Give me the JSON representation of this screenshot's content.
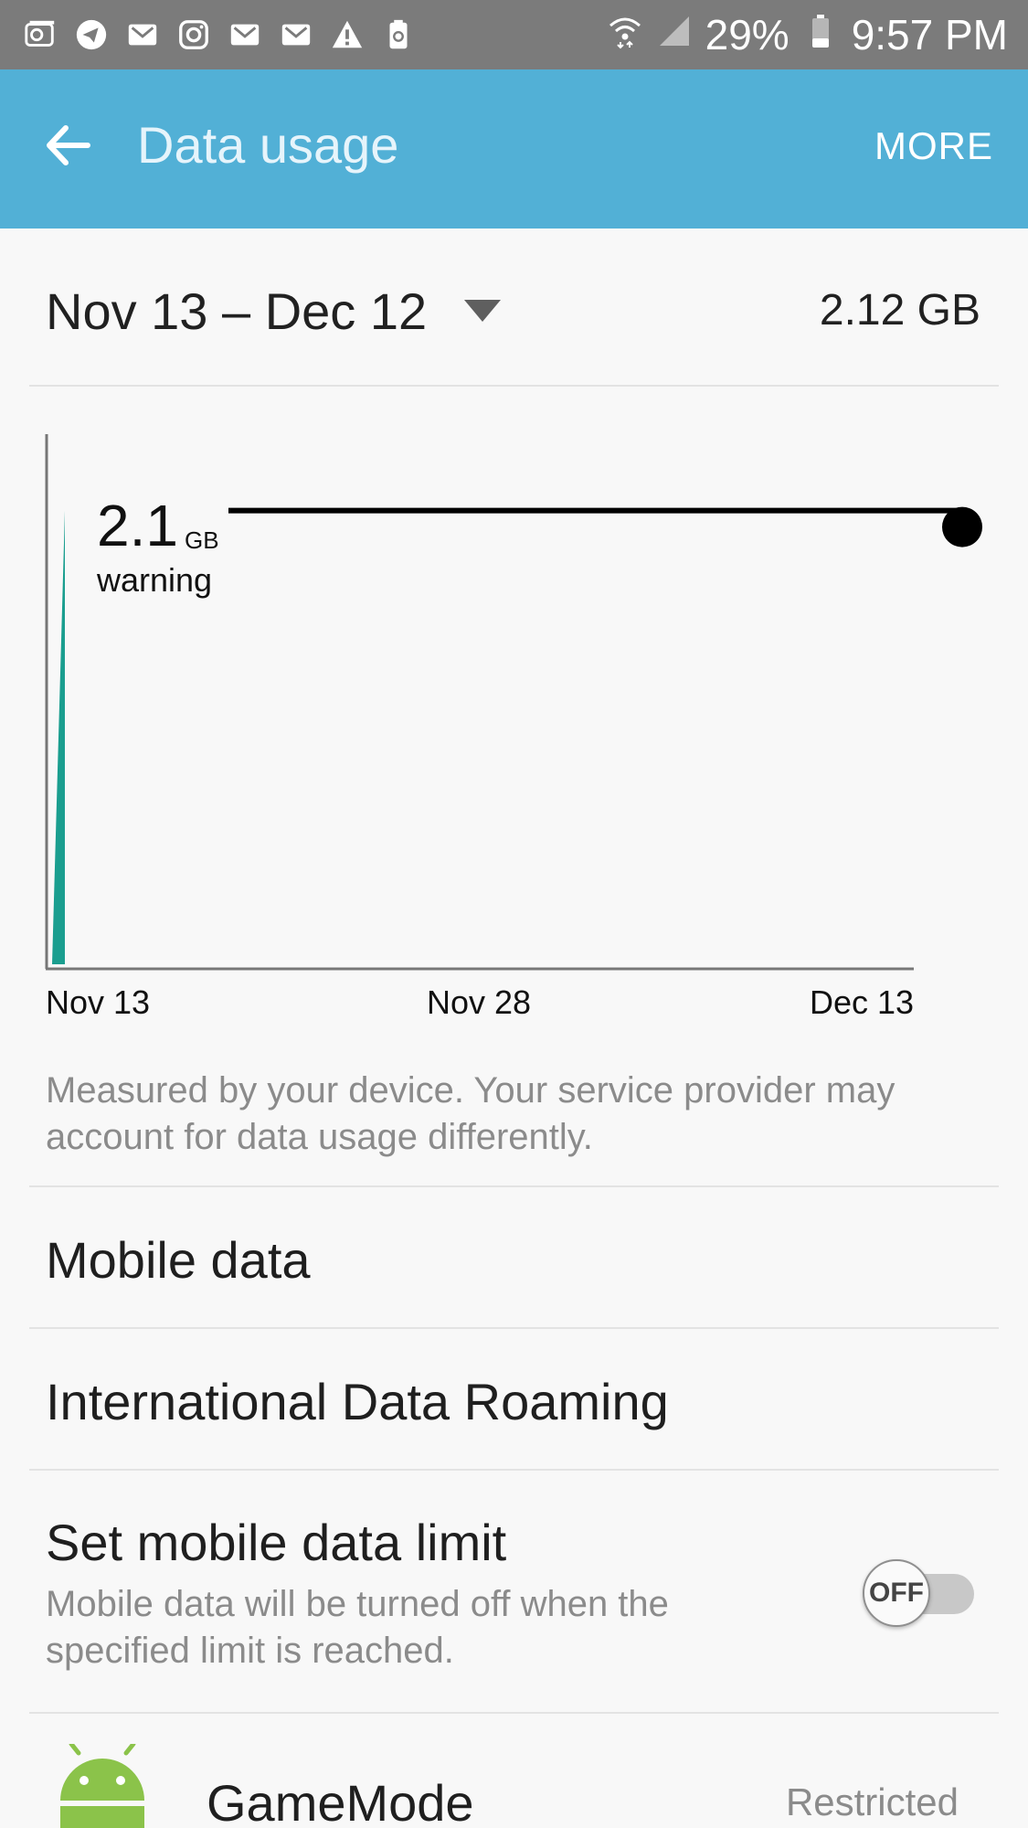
{
  "status_bar": {
    "notification_icons": [
      "voicemail-icon",
      "telegram-icon",
      "gmail-icon",
      "instagram-icon",
      "gmail-icon",
      "gmail-icon",
      "warning-icon",
      "recycle-icon"
    ],
    "battery": "29%",
    "time": "9:57 PM"
  },
  "app_bar": {
    "title": "Data usage",
    "more_label": "MORE"
  },
  "usage": {
    "date_range": "Nov 13 – Dec 12",
    "total": "2.12 GB"
  },
  "chart_data": {
    "type": "area",
    "x_tick_labels": [
      "Nov 13",
      "Nov 28",
      "Dec 13"
    ],
    "series": [
      {
        "x": [
          "Nov 13",
          "Nov 13",
          "Nov 13"
        ],
        "values": [
          0,
          2.1,
          0
        ]
      }
    ],
    "warning_line": {
      "value": "2.1",
      "unit": "GB",
      "label": "warning"
    },
    "colors": {
      "usage": "#1a9e8f",
      "warning_line": "#000000"
    }
  },
  "note": "Measured by your device. Your service provider may account for data usage differently.",
  "settings": {
    "mobile_data": "Mobile data",
    "roaming": "International Data Roaming",
    "limit_title": "Set mobile data limit",
    "limit_sub": "Mobile data will be turned off when the specified limit is reached.",
    "limit_toggle": "OFF"
  },
  "apps": [
    {
      "name": "GameMode",
      "status": "Restricted",
      "icon": "android-icon"
    }
  ],
  "colors": {
    "app_bar": "#52b0d6",
    "status_bar": "#7b7b7b"
  }
}
